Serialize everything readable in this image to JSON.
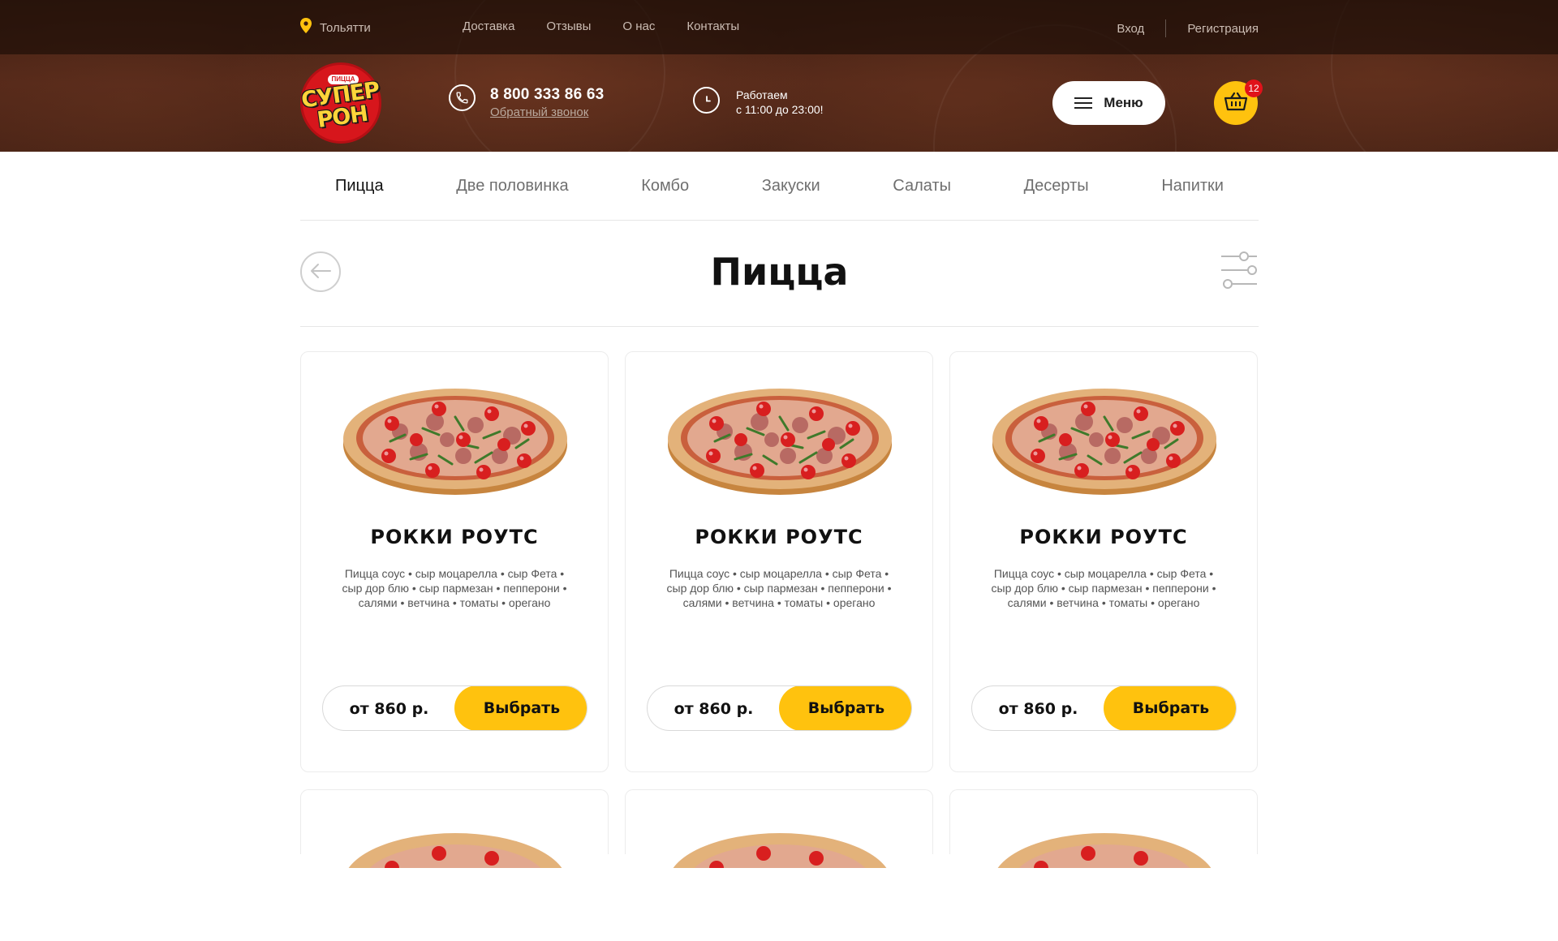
{
  "topbar": {
    "city": "Тольятти",
    "nav": [
      "Доставка",
      "Отзывы",
      "О нас",
      "Контакты"
    ],
    "login": "Вход",
    "register": "Регистрация"
  },
  "header": {
    "logo_small": "ПИЦЦА",
    "logo_line1": "СУПЕР",
    "logo_line2": "РОН",
    "phone": "8 800 333 86 63",
    "callback": "Обратный звонок",
    "hours_line1": "Работаем",
    "hours_line2": "с 11:00 до 23:00!",
    "menu_label": "Меню",
    "cart_count": "12"
  },
  "categories": [
    "Пицца",
    "Две половинка",
    "Комбо",
    "Закуски",
    "Салаты",
    "Десерты",
    "Напитки"
  ],
  "active_category": "Пицца",
  "page_title": "Пицца",
  "products": [
    {
      "name": "РОККИ РОУТС",
      "desc": "Пицца соус • сыр моцарелла • сыр Фета • сыр дор блю • сыр пармезан • пепперони • салями • ветчина • томаты • орегано",
      "price": "от 860 р.",
      "button": "Выбрать"
    },
    {
      "name": "РОККИ РОУТС",
      "desc": "Пицца соус • сыр моцарелла • сыр Фета • сыр дор блю • сыр пармезан • пепперони • салями • ветчина • томаты • орегано",
      "price": "от 860 р.",
      "button": "Выбрать"
    },
    {
      "name": "РОККИ РОУТС",
      "desc": "Пицца соус • сыр моцарелла • сыр Фета • сыр дор блю • сыр пармезан • пепперони • салями • ветчина • томаты • орегано",
      "price": "от 860 р.",
      "button": "Выбрать"
    }
  ],
  "colors": {
    "accent": "#ffc20e",
    "header_dark": "#3e1f12",
    "badge": "#e0121a",
    "logo_red": "#d7161c"
  },
  "icons": {
    "city": "location-pin-icon",
    "phone": "phone-icon",
    "hours": "clock-icon",
    "menu": "hamburger-icon",
    "cart": "basket-icon",
    "back": "arrow-left-icon",
    "filter": "sliders-icon"
  }
}
